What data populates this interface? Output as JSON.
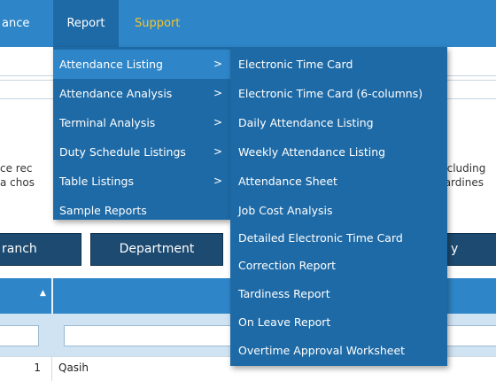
{
  "menubar": {
    "items": [
      {
        "label": "ance"
      },
      {
        "label": "Report"
      },
      {
        "label": "Support"
      }
    ]
  },
  "report_menu": {
    "items": [
      {
        "label": "Attendance Listing",
        "has_submenu": true,
        "highlighted": true
      },
      {
        "label": "Attendance Analysis",
        "has_submenu": true
      },
      {
        "label": "Terminal Analysis",
        "has_submenu": true
      },
      {
        "label": "Duty Schedule Listings",
        "has_submenu": true
      },
      {
        "label": "Table Listings",
        "has_submenu": true
      },
      {
        "label": "Sample Reports",
        "has_submenu": false
      }
    ],
    "chevron_glyph": ">"
  },
  "attendance_listing_submenu": {
    "items": [
      {
        "label": "Electronic Time Card"
      },
      {
        "label": "Electronic Time Card (6-columns)"
      },
      {
        "label": "Daily Attendance Listing"
      },
      {
        "label": "Weekly Attendance Listing"
      },
      {
        "label": "Attendance Sheet"
      },
      {
        "label": "Job Cost Analysis"
      },
      {
        "label": "Detailed Electronic Time Card"
      },
      {
        "label": "Correction Report"
      },
      {
        "label": "Tardiness Report"
      },
      {
        "label": "On Leave Report"
      },
      {
        "label": "Overtime Approval Worksheet"
      }
    ]
  },
  "background": {
    "description_left_line1": "ce rec",
    "description_left_line2": "a chos",
    "description_right_line1": "ncluding",
    "description_right_line2": "tardines"
  },
  "tabs": [
    {
      "label": "ranch"
    },
    {
      "label": "Department"
    },
    {
      "label": "y Roste"
    }
  ],
  "table": {
    "sort_indicator": "▲",
    "rows": [
      {
        "number": "1",
        "name": "Qasih"
      }
    ]
  },
  "colors": {
    "menubar_bg": "#2e86c8",
    "menu_bg": "#1e6aa6",
    "highlight": "#2e86c8",
    "support_text": "#f4c430",
    "tab_bg": "#1c4a70"
  }
}
